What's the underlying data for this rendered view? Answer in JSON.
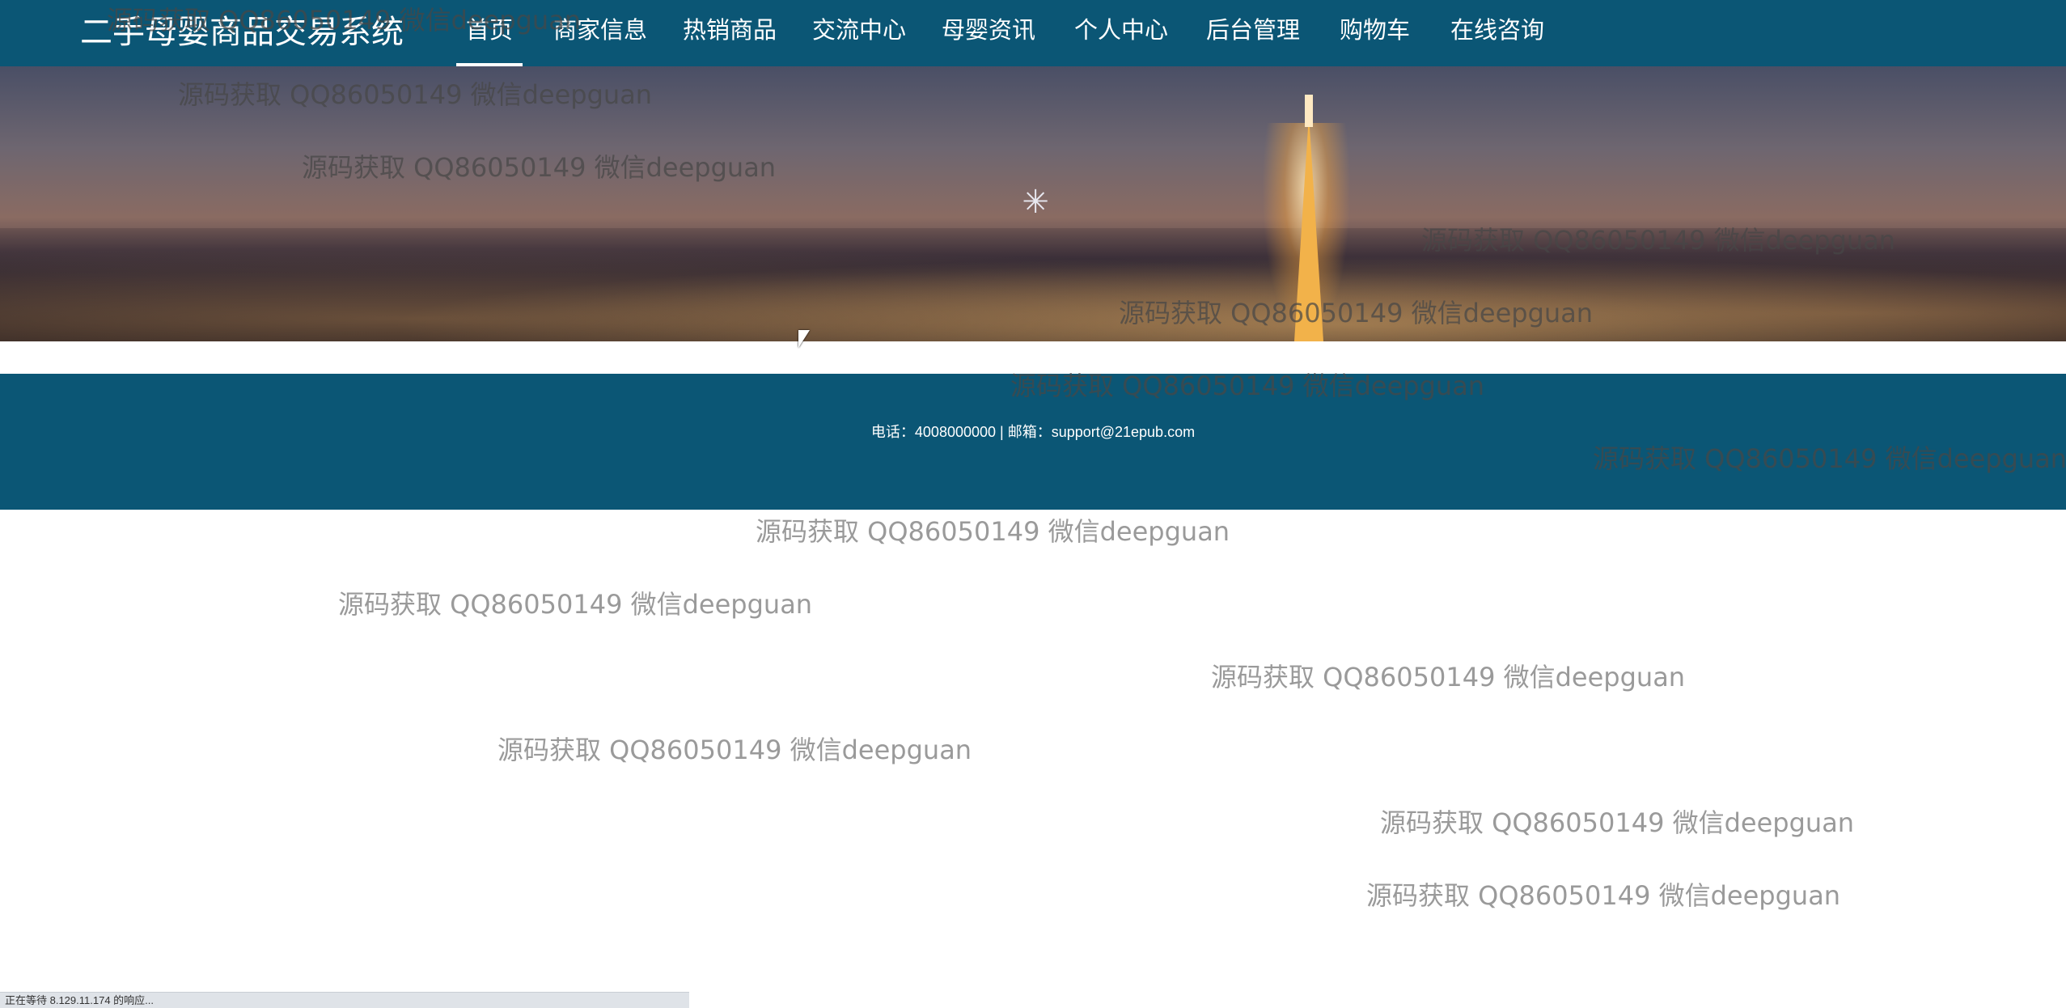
{
  "navbar": {
    "brand": "二手母婴商品交易系统",
    "items": [
      {
        "label": "首页",
        "active": true
      },
      {
        "label": "商家信息"
      },
      {
        "label": "热销商品"
      },
      {
        "label": "交流中心"
      },
      {
        "label": "母婴资讯"
      },
      {
        "label": "个人中心"
      },
      {
        "label": "后台管理"
      },
      {
        "label": "购物车"
      },
      {
        "label": "在线咨询"
      }
    ]
  },
  "banner": {
    "spinner_icon": "loading-spinner-icon",
    "spinner_glyph": "✳"
  },
  "footer": {
    "contact": "电话：4008000000 | 邮箱：support@21epub.com"
  },
  "watermark": {
    "text": "源码获取 QQ86050149 微信deepguan"
  },
  "status_bar": {
    "text": "正在等待 8.129.11.174 的响应..."
  },
  "colors": {
    "nav_background": "#0b5675",
    "footer_background": "#0b5675",
    "text_on_dark": "#ffffff"
  }
}
